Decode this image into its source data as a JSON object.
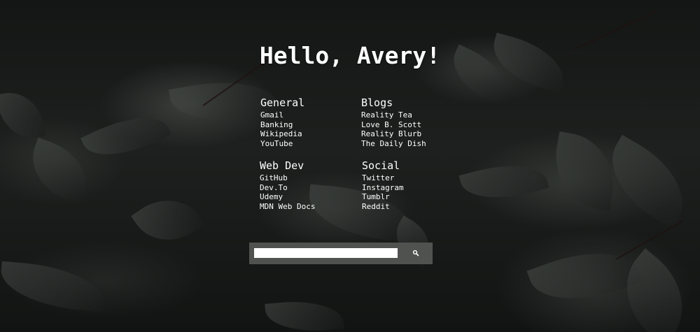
{
  "greeting": "Hello, Avery!",
  "groups": [
    {
      "title": "General",
      "links": [
        "Gmail",
        "Banking",
        "Wikipedia",
        "YouTube"
      ]
    },
    {
      "title": "Blogs",
      "links": [
        "Reality Tea",
        "Love B. Scott",
        "Reality Blurb",
        "The Daily Dish"
      ]
    },
    {
      "title": "Web Dev",
      "links": [
        "GitHub",
        "Dev.To",
        "Udemy",
        "MDN Web Docs"
      ]
    },
    {
      "title": "Social",
      "links": [
        "Twitter",
        "Instagram",
        "Tumblr",
        "Reddit"
      ]
    }
  ],
  "search": {
    "value": "",
    "placeholder": "",
    "button_icon": "search-icon"
  },
  "colors": {
    "text": "#ffffff",
    "search_bar": "#505250"
  }
}
